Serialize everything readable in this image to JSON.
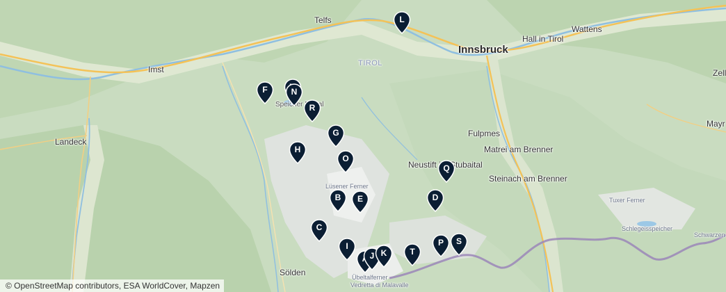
{
  "places": {
    "innsbruck": "Innsbruck",
    "telfs": "Telfs",
    "hall": "Hall in Tirol",
    "wattens": "Wattens",
    "imst": "Imst",
    "landeck": "Landeck",
    "tirol": "TIROL",
    "fulpmes": "Fulpmes",
    "matrei": "Matrei am Brenner",
    "neustift": "Neustift im Stubaital",
    "steinach": "Steinach am Brenner",
    "soelden": "Sölden",
    "zell": "Zell",
    "mayr": "Mayr",
    "speicher_pitztal": "Speicher Pitztal",
    "luesener_ferner": "Lüsener Ferner",
    "tuxer_ferner": "Tuxer Ferner",
    "schlegeisspeicher": "Schlegeisspeicher",
    "schwarzenstein": "Schwarzen",
    "uebeltalferner": "Übeltalferner",
    "vedretta": "Vedretta di Malavalle"
  },
  "markers": [
    {
      "letter": "A"
    },
    {
      "letter": "B"
    },
    {
      "letter": "C"
    },
    {
      "letter": "D"
    },
    {
      "letter": "E"
    },
    {
      "letter": "F"
    },
    {
      "letter": "G"
    },
    {
      "letter": "H"
    },
    {
      "letter": "I"
    },
    {
      "letter": "J"
    },
    {
      "letter": "K"
    },
    {
      "letter": "L"
    },
    {
      "letter": "M"
    },
    {
      "letter": "N"
    },
    {
      "letter": "O"
    },
    {
      "letter": "P"
    },
    {
      "letter": "Q"
    },
    {
      "letter": "R"
    },
    {
      "letter": "S"
    },
    {
      "letter": "T"
    }
  ],
  "marker_color": "#0b1e33",
  "border_color": "#9b86b8",
  "attribution": "© OpenStreetMap contributors, ESA WorldCover, Mapzen"
}
